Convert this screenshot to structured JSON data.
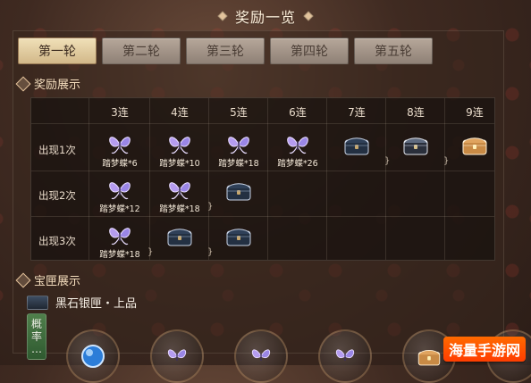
{
  "header": {
    "title": "奖励一览"
  },
  "tabs": [
    {
      "label": "第一轮",
      "active": true
    },
    {
      "label": "第二轮",
      "active": false
    },
    {
      "label": "第三轮",
      "active": false
    },
    {
      "label": "第四轮",
      "active": false
    },
    {
      "label": "第五轮",
      "active": false
    }
  ],
  "rewards_section": {
    "title": "奖励展示",
    "columns": [
      "3连",
      "4连",
      "5连",
      "6连",
      "7连",
      "8连",
      "9连"
    ],
    "rows": [
      {
        "label": "出现1次",
        "cells": [
          {
            "icon": "butterfly-icon",
            "text": "踏梦蝶*6"
          },
          {
            "icon": "butterfly-icon",
            "text": "踏梦蝶*10"
          },
          {
            "icon": "butterfly-icon",
            "text": "踏梦蝶*18"
          },
          {
            "icon": "butterfly-icon",
            "text": "踏梦蝶*26"
          },
          {
            "icon": "chest-dark-icon",
            "text": ""
          },
          {
            "icon": "chest-silver-icon",
            "text": ""
          },
          {
            "icon": "chest-gold-icon",
            "text": ""
          }
        ]
      },
      {
        "label": "出现2次",
        "cells": [
          {
            "icon": "butterfly-icon",
            "text": "踏梦蝶*12"
          },
          {
            "icon": "butterfly-icon",
            "text": "踏梦蝶*18"
          },
          {
            "icon": "chest-dark-icon",
            "text": ""
          },
          {
            "icon": "",
            "text": ""
          },
          {
            "icon": "",
            "text": ""
          },
          {
            "icon": "",
            "text": ""
          },
          {
            "icon": "",
            "text": ""
          }
        ]
      },
      {
        "label": "出现3次",
        "cells": [
          {
            "icon": "butterfly-icon",
            "text": "踏梦蝶*18"
          },
          {
            "icon": "chest-dark-icon",
            "text": ""
          },
          {
            "icon": "chest-dark-icon",
            "text": ""
          },
          {
            "icon": "",
            "text": ""
          },
          {
            "icon": "",
            "text": ""
          },
          {
            "icon": "",
            "text": ""
          },
          {
            "icon": "",
            "text": ""
          }
        ]
      }
    ],
    "tick_glyph": "}"
  },
  "chest_section": {
    "title": "宝匣展示",
    "item_title": "黑石银匣・上品",
    "probability_label_lines": [
      "概",
      "率",
      "…"
    ],
    "bottom_item_icons": [
      "orb-icon",
      "butterfly-icon",
      "butterfly-icon",
      "butterfly-icon",
      "chest-gold-icon",
      "butterfly-icon"
    ]
  },
  "watermark": {
    "text": "海量手游网"
  },
  "colors": {
    "accent_gold": "#e2c39c",
    "tab_active": "#f0e0b8",
    "butterfly": "#a98fe0"
  }
}
